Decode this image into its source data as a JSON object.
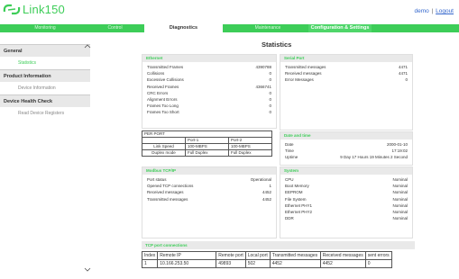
{
  "header": {
    "app_title": "Link150",
    "user_name": "demo",
    "separator": "|",
    "logout_label": "Logout"
  },
  "nav": {
    "tabs": [
      {
        "label": "Monitoring"
      },
      {
        "label": "Control"
      },
      {
        "label": "Diagnostics"
      },
      {
        "label": "Maintenance"
      },
      {
        "label": "Configuration & Settings"
      }
    ]
  },
  "sidebar": {
    "sections": [
      {
        "title": "General",
        "items": [
          "Statistics"
        ]
      },
      {
        "title": "Product Information",
        "items": [
          "Device Information"
        ]
      },
      {
        "title": "Device Health Check",
        "items": [
          "Read Device Registers"
        ]
      }
    ]
  },
  "main": {
    "title": "Statistics",
    "ethernet": {
      "title": "Ethernet",
      "rows": [
        {
          "k": "Transmitted Frames",
          "v": "4390788"
        },
        {
          "k": "Collisions",
          "v": "0"
        },
        {
          "k": "Excessive Collisions",
          "v": "0"
        },
        {
          "k": "Received Frames",
          "v": "4366741"
        },
        {
          "k": "CRC Errors",
          "v": "0"
        },
        {
          "k": "Alignment Errors",
          "v": "0"
        },
        {
          "k": "Frames Too Long",
          "v": "0"
        },
        {
          "k": "Frames Too Short",
          "v": "0"
        }
      ]
    },
    "per_port": {
      "title": "PER PORT",
      "headers": [
        "",
        "Port-1",
        "Port-2"
      ],
      "rows": [
        [
          "Link Speed",
          "100-MBPS",
          "100-MBPS"
        ],
        [
          "Duplex mode",
          "Full Duplex",
          "Full Duplex"
        ]
      ]
    },
    "serial": {
      "title": "Serial Port",
      "rows": [
        {
          "k": "Transmitted messages",
          "v": "4471"
        },
        {
          "k": "Received messages",
          "v": "4471"
        },
        {
          "k": "Error Messages",
          "v": "0"
        }
      ]
    },
    "datetime": {
      "title": "Date and time",
      "rows": [
        {
          "k": "Date",
          "v": "2000-01-10"
        },
        {
          "k": "Time",
          "v": "17:19:02"
        },
        {
          "k": "Uptime",
          "v": "9 Day 17 Hours 19 Minutes 2 Second"
        }
      ]
    },
    "modbus": {
      "title": "Modbus TCP/IP",
      "rows": [
        {
          "k": "Port status",
          "v": "Operational"
        },
        {
          "k": "Opened TCP connections",
          "v": "1"
        },
        {
          "k": "Received messages",
          "v": "4452"
        },
        {
          "k": "Transmitted messages",
          "v": "4452"
        }
      ]
    },
    "system": {
      "title": "System",
      "rows": [
        {
          "k": "CPU",
          "v": "Nominal"
        },
        {
          "k": "Boot Memory",
          "v": "Nominal"
        },
        {
          "k": "EEPROM",
          "v": "Nominal"
        },
        {
          "k": "File System",
          "v": "Nominal"
        },
        {
          "k": "Ethernet PHY1",
          "v": "Nominal"
        },
        {
          "k": "Ethernet PHY2",
          "v": "Nominal"
        },
        {
          "k": "DDR",
          "v": "Nominal"
        }
      ]
    },
    "tcp": {
      "title": "TCP port connections",
      "headers": [
        "Index",
        "Remote IP",
        "Remote port",
        "Local port",
        "Transmitted messages",
        "Received messages",
        "sent errors"
      ],
      "rows": [
        [
          "1",
          "10.166.253.50",
          "49893",
          "502",
          "4452",
          "4452",
          "0"
        ]
      ]
    }
  },
  "colors": {
    "accent": "#3dcd58",
    "panel_header": "#e9e9e9",
    "link": "#3366cc"
  }
}
